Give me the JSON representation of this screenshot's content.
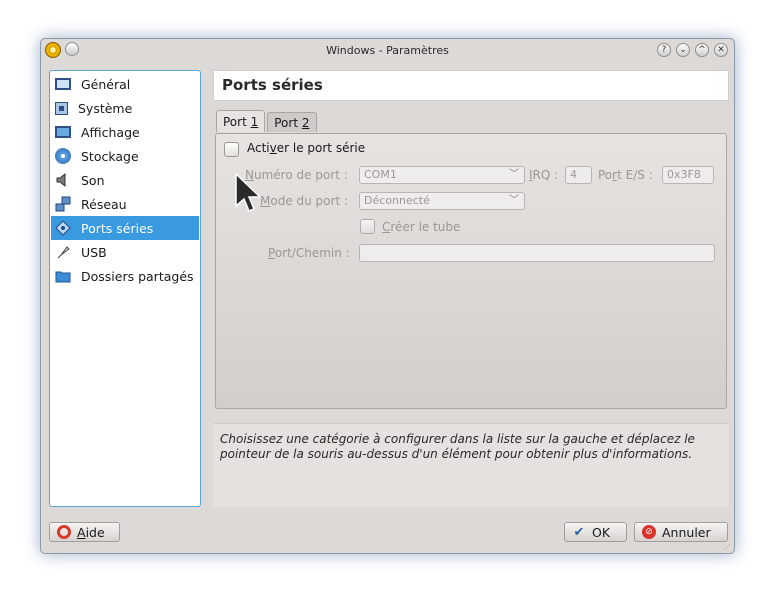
{
  "window": {
    "title": "Windows - Paramètres",
    "title_buttons": [
      "?",
      "⌄",
      "^",
      "✕"
    ]
  },
  "sidebar": {
    "items": [
      {
        "label": "Général",
        "icon": "monitor-icon"
      },
      {
        "label": "Système",
        "icon": "chip-icon"
      },
      {
        "label": "Affichage",
        "icon": "display-icon"
      },
      {
        "label": "Stockage",
        "icon": "disk-icon"
      },
      {
        "label": "Son",
        "icon": "speaker-icon"
      },
      {
        "label": "Réseau",
        "icon": "network-icon"
      },
      {
        "label": "Ports séries",
        "icon": "serial-port-icon",
        "selected": true
      },
      {
        "label": "USB",
        "icon": "usb-icon"
      },
      {
        "label": "Dossiers partagés",
        "icon": "folder-icon"
      }
    ]
  },
  "header": {
    "title": "Ports séries"
  },
  "tabs": [
    {
      "pre": "Port ",
      "key": "1",
      "active": true
    },
    {
      "pre": "Port ",
      "key": "2",
      "active": false
    }
  ],
  "panel": {
    "enable_label": {
      "pre": "Acti",
      "key": "v",
      "post": "er le port série"
    },
    "port_number_label": {
      "pre": "",
      "key": "N",
      "post": "uméro de port :"
    },
    "port_number_value": "COM1",
    "irq_label": {
      "pre": "",
      "key": "I",
      "post": "RQ :"
    },
    "irq_value": "4",
    "io_port_label": {
      "pre": "Po",
      "key": "r",
      "post": "t E/S :"
    },
    "io_port_value": "0x3F8",
    "mode_label": {
      "pre": "",
      "key": "M",
      "post": "ode du port :"
    },
    "mode_value": "Déconnecté",
    "create_pipe_label": {
      "pre": "",
      "key": "C",
      "post": "réer le tube"
    },
    "path_label": {
      "pre": "",
      "key": "P",
      "post": "ort/Chemin :"
    },
    "path_value": ""
  },
  "info": {
    "text": "Choisissez une catégorie à configurer dans la liste sur la gauche et déplacez le pointeur de la souris au-dessus d'un élément pour obtenir plus d'informations."
  },
  "buttons": {
    "help": {
      "pre": "",
      "key": "A",
      "post": "ide"
    },
    "ok": "OK",
    "cancel": "Annuler"
  },
  "colors": {
    "selection": "#3a9ae0",
    "window_bg": "#dcd9d7",
    "border_focus": "#5aa4d8"
  }
}
